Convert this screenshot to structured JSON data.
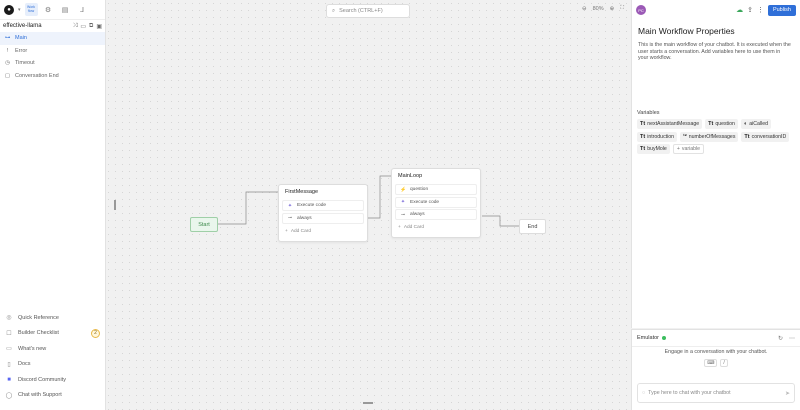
{
  "topbar": {
    "logo_icon": "chatbot-logo-icon",
    "tabs": [
      {
        "name": "workflows",
        "label": "Work flow",
        "active": true
      },
      {
        "name": "settings",
        "label": "",
        "active": false
      },
      {
        "name": "tables",
        "label": "",
        "active": false
      },
      {
        "name": "hooks",
        "label": "",
        "active": false
      }
    ]
  },
  "bot": {
    "name": "effective-llama"
  },
  "workflows": [
    {
      "label": "Main",
      "icon": "workflow-icon",
      "active": true
    },
    {
      "label": "Error",
      "icon": "error-icon",
      "active": false
    },
    {
      "label": "Timeout",
      "icon": "clock-icon",
      "active": false
    },
    {
      "label": "Conversation End",
      "icon": "end-icon",
      "active": false
    }
  ],
  "bottom_nav": [
    {
      "label": "Quick Reference",
      "icon": "book-icon"
    },
    {
      "label": "Builder Checklist",
      "icon": "checklist-icon",
      "badge": "2"
    },
    {
      "label": "What's new",
      "icon": "news-icon"
    },
    {
      "label": "Docs",
      "icon": "docs-icon"
    },
    {
      "label": "Discord Community",
      "icon": "discord-icon"
    },
    {
      "label": "Chat with Support",
      "icon": "chat-icon"
    }
  ],
  "canvas": {
    "search_placeholder": "Search (CTRL+F)",
    "zoom": "80%",
    "start_label": "Start",
    "end_label": "End",
    "nodes": [
      {
        "title": "FirstMessage",
        "cards": [
          {
            "label": "Execute code",
            "type": "code"
          },
          {
            "label": "always",
            "type": "transition"
          }
        ],
        "add_card": "Add Card"
      },
      {
        "title": "MainLoop",
        "cards": [
          {
            "label": "question",
            "type": "q"
          },
          {
            "label": "Execute code",
            "type": "code"
          },
          {
            "label": "always",
            "type": "transition"
          }
        ],
        "add_card": "Add Card"
      }
    ]
  },
  "panel": {
    "avatar_initials": "PC",
    "publish_label": "Publish",
    "title": "Main Workflow Properties",
    "description": "This is the main workflow of your chatbot. It is executed when the user starts a conversation. Add variables here to use them in your workflow.",
    "variables_label": "Variables",
    "variables": [
      {
        "name": "nextAssistantMessage",
        "type": "Tt"
      },
      {
        "name": "question",
        "type": "Tt"
      },
      {
        "name": "aiCalled",
        "type": "bool"
      },
      {
        "name": "introduction",
        "type": "Tt"
      },
      {
        "name": "numberOfMessages",
        "type": "num"
      },
      {
        "name": "conversationID",
        "type": "Tt"
      },
      {
        "name": "buyMole",
        "type": "Tt"
      }
    ],
    "add_variable": "variable"
  },
  "emulator": {
    "title": "Emulator",
    "message": "Engage in a conversation with your chatbot.",
    "shortcut_keys": [
      "⌨",
      "/"
    ],
    "input_placeholder": "Type here to chat with your chatbot"
  },
  "colors": {
    "accent": "#2f6fd8",
    "start_green": "#3d8a4c",
    "online": "#3cbd5e"
  }
}
